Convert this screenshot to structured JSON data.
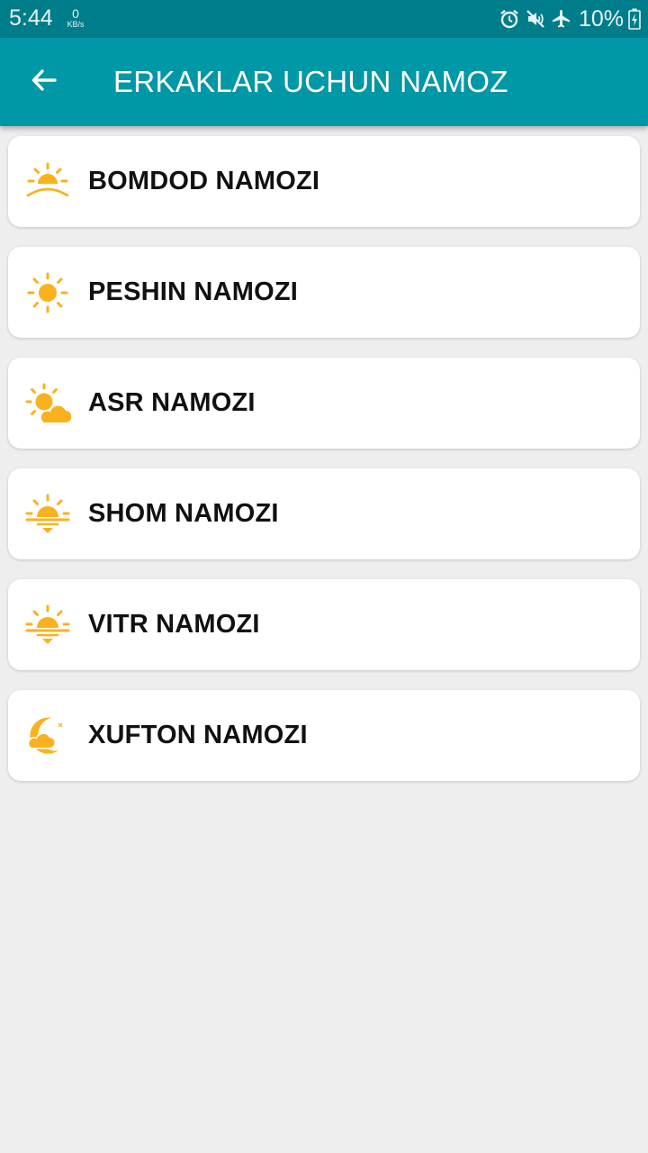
{
  "status_bar": {
    "time": "5:44",
    "net_speed_value": "0",
    "net_speed_unit": "KB/s",
    "battery_percent": "10%"
  },
  "app_bar": {
    "title": "ERKAKLAR UCHUN NAMOZ",
    "back_icon": "arrow-left-icon"
  },
  "prayers": [
    {
      "label": "BOMDOD NAMOZI",
      "icon": "sunrise-icon"
    },
    {
      "label": "PESHIN NAMOZI",
      "icon": "sun-icon"
    },
    {
      "label": "ASR NAMOZI",
      "icon": "sun-cloud-icon"
    },
    {
      "label": "SHOM NAMOZI",
      "icon": "sunset-icon"
    },
    {
      "label": "VITR NAMOZI",
      "icon": "sunset-icon"
    },
    {
      "label": "XUFTON NAMOZI",
      "icon": "moon-cloud-icon"
    }
  ],
  "colors": {
    "status_bar": "#007d8a",
    "app_bar": "#0097a7",
    "icon_accent": "#f9b21d",
    "background": "#eeeeee"
  }
}
